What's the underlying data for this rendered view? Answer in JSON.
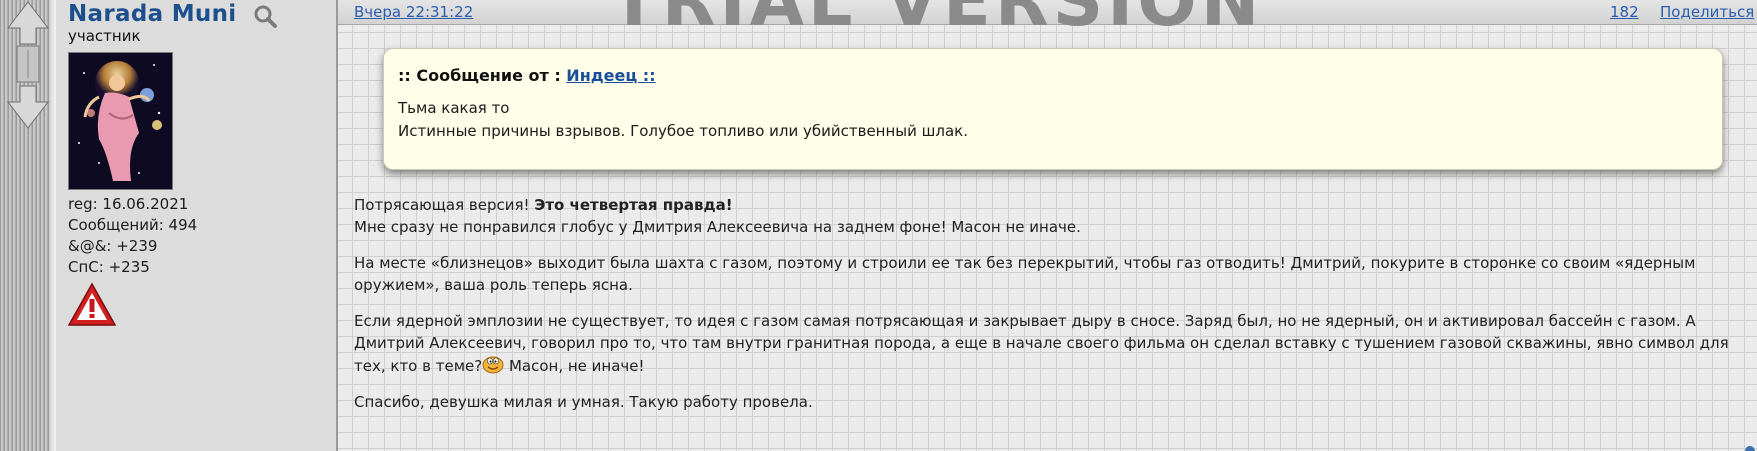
{
  "user": {
    "name": "Narada Muni",
    "rank": "участник",
    "stats": [
      "reg: 16.06.2021",
      "Сообщений: 494",
      "&@&: +239",
      "СпС: +235"
    ]
  },
  "post": {
    "watermark": "TRIAL VERSION",
    "date": "Вчера 22:31:22",
    "number": "182",
    "share": "Поделиться",
    "quote": {
      "prefix": ":: Сообщение от : ",
      "author": "Индеец ::",
      "lines": [
        "Тьма какая то",
        "Истинные причины взрывов. Голубое топливо или убийственный шлак."
      ]
    },
    "p1_intro": "Потрясающая версия! ",
    "p1_bold": "Это четвертая правда!",
    "p1_line2": "Мне сразу не понравился глобус у Дмитрия Алексеевича на заднем фоне! Масон не иначе.",
    "p2": "На месте «близнецов» выходит была шахта с газом, поэтому и строили ее так без перекрытий, чтобы газ отводить! Дмитрий, покурите в сторонке со своим «ядерным оружием», ваша роль теперь ясна.",
    "p3_before": "Если ядерной эмплозии не существует, то идея с газом самая потрясающая и закрывает дыру в сносе. Заряд был, но не ядерный, он и активировал бассейн с газом. А Дмитрий Алексеевич, говорил про то, что там внутри гранитная порода, а еще в начале своего фильма он сделал вставку с тушением газовой скважины, явно символ для тех, кто в теме?",
    "p3_after": " Масон, не иначе!",
    "p4": "Спасибо, девушка милая и умная. Такую работу провела."
  },
  "colors": {
    "username": "#1d4f8c",
    "link": "#2a5db0",
    "quote_bg": "#fefee9"
  },
  "icons": [
    "search-icon",
    "warning-icon",
    "smiley-icon",
    "arrows-icon"
  ]
}
